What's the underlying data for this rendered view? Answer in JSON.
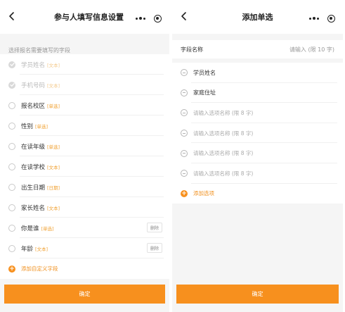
{
  "left": {
    "title": "参与人填写信息设置",
    "hint": "选择报名需要填写的字段",
    "fields": [
      {
        "label": "学员姓名",
        "tag": "[文本]",
        "state": "locked"
      },
      {
        "label": "手机号码",
        "tag": "[文本]",
        "state": "locked"
      },
      {
        "label": "报名校区",
        "tag": "[单选]",
        "state": "unchecked"
      },
      {
        "label": "性别",
        "tag": "[单选]",
        "state": "unchecked"
      },
      {
        "label": "在读年级",
        "tag": "[单选]",
        "state": "unchecked"
      },
      {
        "label": "在读学校",
        "tag": "[文本]",
        "state": "unchecked"
      },
      {
        "label": "出生日期",
        "tag": "[日期]",
        "state": "unchecked"
      },
      {
        "label": "家长姓名",
        "tag": "[文本]",
        "state": "unchecked"
      },
      {
        "label": "你是谁",
        "tag": "[单选]",
        "state": "unchecked",
        "delete_label": "删除"
      },
      {
        "label": "年龄",
        "tag": "[文本]",
        "state": "unchecked",
        "delete_label": "删除"
      }
    ],
    "add_label": "添加自定义字段",
    "confirm_label": "确定"
  },
  "right": {
    "title": "添加单选",
    "field_name_label": "字段名称",
    "field_name_placeholder": "请输入 (限 10 字)",
    "options": [
      {
        "text": "学员姓名"
      },
      {
        "text": "家庭住址"
      }
    ],
    "option_placeholder": "请输入选项名称 (限 8 字)",
    "add_label": "添加选项",
    "confirm_label": "确定"
  }
}
